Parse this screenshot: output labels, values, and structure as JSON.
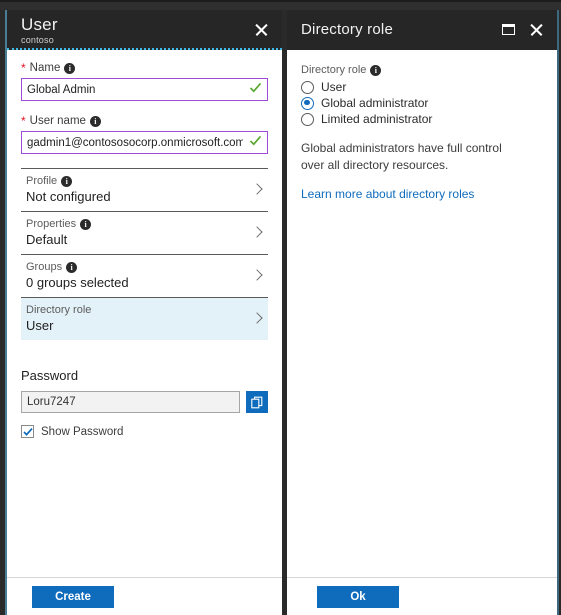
{
  "colors": {
    "header_bg": "#262626",
    "accent_blue": "#0f6cbd",
    "input_border_purple": "#a04bd3",
    "valid_green": "#5aa832",
    "selected_row_bg": "#e3f1f8",
    "blade_edge_teal": "#4b7d96",
    "required_red": "#e81123"
  },
  "left_blade": {
    "title": "User",
    "subtitle": "contoso",
    "close_icon": "close-icon",
    "fields": [
      {
        "label": "Name",
        "required": true,
        "info_icon": "info-icon",
        "value": "Global Admin",
        "placeholder": "Name",
        "valid": true
      },
      {
        "label": "User name",
        "required": true,
        "info_icon": "info-icon",
        "value": "gadmin1@contososocorp.onmicrosoft.com",
        "placeholder": "User name",
        "valid": true
      }
    ],
    "nav_rows": [
      {
        "label": "Profile",
        "value": "Not configured",
        "has_info": true,
        "selected": false,
        "chevron_icon": "chevron-right-icon"
      },
      {
        "label": "Properties",
        "value": "Default",
        "has_info": true,
        "selected": false,
        "chevron_icon": "chevron-right-icon"
      },
      {
        "label": "Groups",
        "value": "0 groups selected",
        "has_info": true,
        "selected": false,
        "chevron_icon": "chevron-right-icon"
      },
      {
        "label": "Directory role",
        "value": "User",
        "has_info": false,
        "selected": true,
        "chevron_icon": "chevron-right-icon"
      }
    ],
    "password": {
      "heading": "Password",
      "value": "Loru7247",
      "placeholder": "Password",
      "copy_icon": "copy-icon",
      "show_password_label": "Show Password",
      "show_password_checked": true
    },
    "footer": {
      "create_label": "Create"
    }
  },
  "right_blade": {
    "title": "Directory role",
    "maximize_icon": "maximize-icon",
    "close_icon": "close-icon",
    "group_label": "Directory role",
    "info_icon": "info-icon",
    "options": [
      {
        "label": "User",
        "checked": false
      },
      {
        "label": "Global administrator",
        "checked": true
      },
      {
        "label": "Limited administrator",
        "checked": false
      }
    ],
    "description": "Global administrators have full control over all directory resources.",
    "link_label": "Learn more about directory roles",
    "footer": {
      "ok_label": "Ok"
    }
  }
}
